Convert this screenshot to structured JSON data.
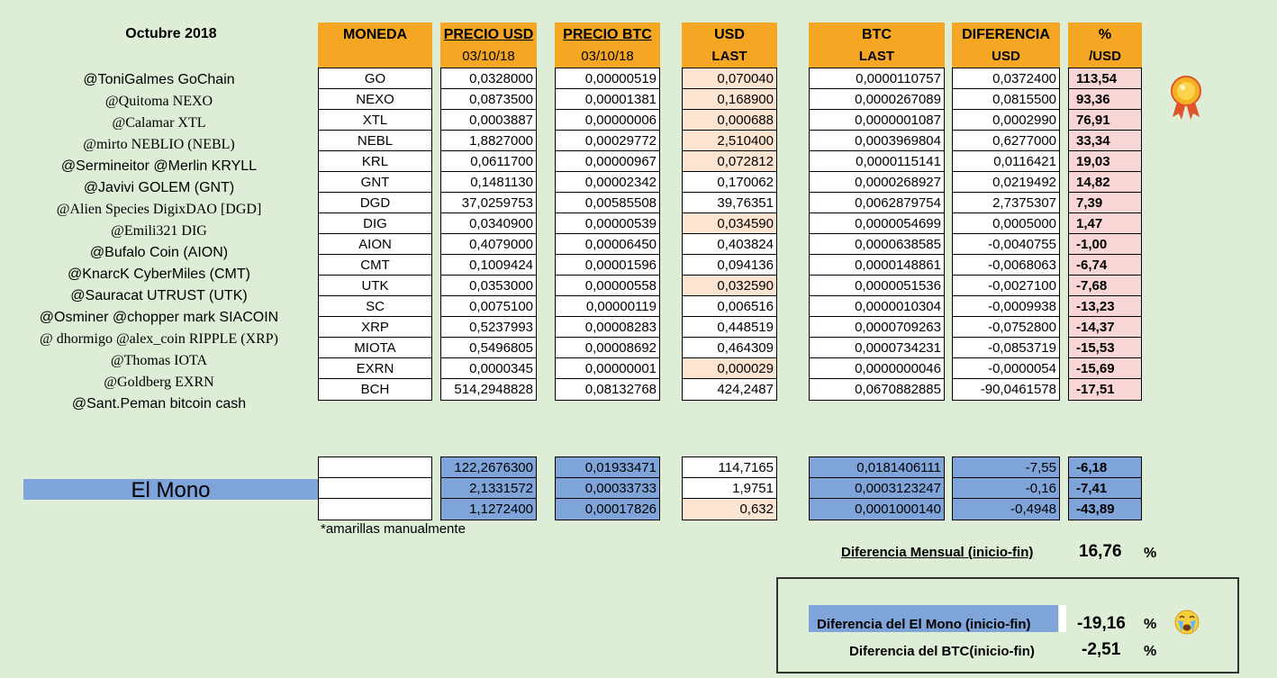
{
  "title": "Octubre 2018",
  "headers": {
    "moneda": "MONEDA",
    "precio_usd": "PRECIO USD",
    "precio_usd_date": "03/10/18",
    "precio_btc": "PRECIO BTC",
    "precio_btc_date": "03/10/18",
    "usd": "USD",
    "usd_sub": "LAST",
    "btc": "BTC",
    "btc_sub": "LAST",
    "diferencia": "DIFERENCIA",
    "diferencia_sub": "USD",
    "pct": "%",
    "pct_sub": "/USD"
  },
  "rows": [
    {
      "name": "@ToniGalmes GoChain",
      "moneda": "GO",
      "precio_usd": "0,0328000",
      "precio_btc": "0,00000519",
      "usd_last": "0,070040",
      "btc_last": "0,0000110757",
      "dif_usd": "0,0372400",
      "pct": "113,54",
      "peach": true
    },
    {
      "name": "@Quitoma NEXO",
      "moneda": "NEXO",
      "precio_usd": "0,0873500",
      "precio_btc": "0,00001381",
      "usd_last": "0,168900",
      "btc_last": "0,0000267089",
      "dif_usd": "0,0815500",
      "pct": "93,36",
      "peach": true
    },
    {
      "name": "@Calamar XTL",
      "moneda": "XTL",
      "precio_usd": "0,0003887",
      "precio_btc": "0,00000006",
      "usd_last": "0,000688",
      "btc_last": "0,0000001087",
      "dif_usd": "0,0002990",
      "pct": "76,91",
      "peach": true
    },
    {
      "name": "@mirto NEBLIO (NEBL)",
      "moneda": "NEBL",
      "precio_usd": "1,8827000",
      "precio_btc": "0,00029772",
      "usd_last": "2,510400",
      "btc_last": "0,0003969804",
      "dif_usd": "0,6277000",
      "pct": "33,34",
      "peach": true
    },
    {
      "name": "@Sermineitor  @Merlin KRYLL",
      "moneda": "KRL",
      "precio_usd": "0,0611700",
      "precio_btc": "0,00000967",
      "usd_last": "0,072812",
      "btc_last": "0,0000115141",
      "dif_usd": "0,0116421",
      "pct": "19,03",
      "peach": true
    },
    {
      "name": "@Javivi GOLEM (GNT)",
      "moneda": "GNT",
      "precio_usd": "0,1481130",
      "precio_btc": "0,00002342",
      "usd_last": "0,170062",
      "btc_last": "0,0000268927",
      "dif_usd": "0,0219492",
      "pct": "14,82",
      "peach": false
    },
    {
      "name": "@Alien Species DigixDAO [DGD]",
      "moneda": "DGD",
      "precio_usd": "37,0259753",
      "precio_btc": "0,00585508",
      "usd_last": "39,76351",
      "btc_last": "0,0062879754",
      "dif_usd": "2,7375307",
      "pct": "7,39",
      "peach": false
    },
    {
      "name": "@Emili321 DIG",
      "moneda": "DIG",
      "precio_usd": "0,0340900",
      "precio_btc": "0,00000539",
      "usd_last": "0,034590",
      "btc_last": "0,0000054699",
      "dif_usd": "0,0005000",
      "pct": "1,47",
      "peach": true
    },
    {
      "name": "@Bufalo Coin (AION)",
      "moneda": "AION",
      "precio_usd": "0,4079000",
      "precio_btc": "0,00006450",
      "usd_last": "0,403824",
      "btc_last": "0,0000638585",
      "dif_usd": "-0,0040755",
      "pct": "-1,00",
      "peach": false
    },
    {
      "name": "@KnarcK CyberMiles (CMT)",
      "moneda": "CMT",
      "precio_usd": "0,1009424",
      "precio_btc": "0,00001596",
      "usd_last": "0,094136",
      "btc_last": "0,0000148861",
      "dif_usd": "-0,0068063",
      "pct": "-6,74",
      "peach": false
    },
    {
      "name": "@Sauracat UTRUST (UTK)",
      "moneda": "UTK",
      "precio_usd": "0,0353000",
      "precio_btc": "0,00000558",
      "usd_last": "0,032590",
      "btc_last": "0,0000051536",
      "dif_usd": "-0,0027100",
      "pct": "-7,68",
      "peach": true
    },
    {
      "name": "@Osminer @chopper mark  SIACOIN",
      "moneda": "SC",
      "precio_usd": "0,0075100",
      "precio_btc": "0,00000119",
      "usd_last": "0,006516",
      "btc_last": "0,0000010304",
      "dif_usd": "-0,0009938",
      "pct": "-13,23",
      "peach": false
    },
    {
      "name": "@ dhormigo @alex_coin RIPPLE (XRP)",
      "moneda": "XRP",
      "precio_usd": "0,5237993",
      "precio_btc": "0,00008283",
      "usd_last": "0,448519",
      "btc_last": "0,0000709263",
      "dif_usd": "-0,0752800",
      "pct": "-14,37",
      "peach": false
    },
    {
      "name": "@Thomas IOTA",
      "moneda": "MIOTA",
      "precio_usd": "0,5496805",
      "precio_btc": "0,00008692",
      "usd_last": "0,464309",
      "btc_last": "0,0000734231",
      "dif_usd": "-0,0853719",
      "pct": "-15,53",
      "peach": false
    },
    {
      "name": "@Goldberg EXRN",
      "moneda": "EXRN",
      "precio_usd": "0,0000345",
      "precio_btc": "0,00000001",
      "usd_last": "0,000029",
      "btc_last": "0,0000000046",
      "dif_usd": "-0,0000054",
      "pct": "-15,69",
      "peach": true
    },
    {
      "name": "@Sant.Peman bitcoin cash",
      "moneda": "BCH",
      "precio_usd": "514,2948828",
      "precio_btc": "0,08132768",
      "usd_last": "424,2487",
      "btc_last": "0,0670882885",
      "dif_usd": "-90,0461578",
      "pct": "-17,51",
      "peach": false
    }
  ],
  "summary": [
    {
      "precio_usd": "122,2676300",
      "precio_btc": "0,01933471",
      "usd_last": "114,7165",
      "btc_last": "0,0181406111",
      "dif_usd": "-7,55",
      "pct": "-6,18",
      "peach": false
    },
    {
      "precio_usd": "2,1331572",
      "precio_btc": "0,00033733",
      "usd_last": "1,9751",
      "btc_last": "0,0003123247",
      "dif_usd": "-0,16",
      "pct": "-7,41",
      "peach": false
    },
    {
      "precio_usd": "1,1272400",
      "precio_btc": "0,00017826",
      "usd_last": "0,632",
      "btc_last": "0,0001000140",
      "dif_usd": "-0,4948",
      "pct": "-43,89",
      "peach": true
    }
  ],
  "mono_label": "El Mono",
  "note": "*amarillas manualmente",
  "diff_mensual": {
    "label": "Diferencia Mensual (inicio-fin)",
    "value": "16,76",
    "unit": "%"
  },
  "diff_mono": {
    "label": "Diferencia del El Mono (inicio-fin)",
    "value": "-19,16",
    "unit": "%"
  },
  "diff_btc": {
    "label": "Diferencia del BTC(inicio-fin)",
    "value": "-2,51",
    "unit": "%"
  },
  "icons": {
    "medal": "award-medal-icon",
    "crying": "crying-face-icon"
  },
  "colors": {
    "background": "#deeed6",
    "header_orange": "#f5a623",
    "peach": "#fce4d0",
    "pink": "#f9d6d6",
    "blue": "#7fa4d9"
  }
}
